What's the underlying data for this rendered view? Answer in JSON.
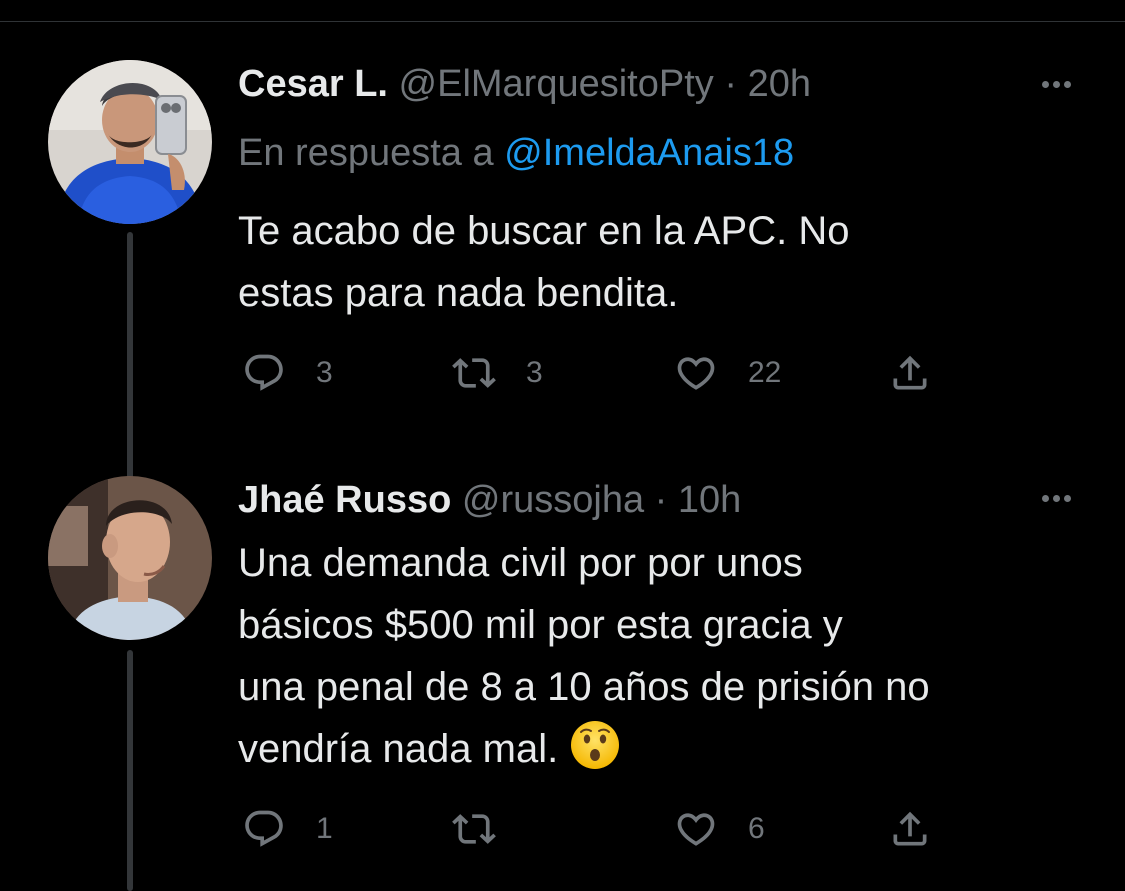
{
  "theme": {
    "background": "#000000",
    "text": "#e7e9ea",
    "secondary": "#71767b",
    "link": "#1d9bf0"
  },
  "tweets": [
    {
      "name": "Cesar L.",
      "handle": "@ElMarquesitoPty",
      "dot": "·",
      "time": "20h",
      "reply_prefix": "En respuesta a",
      "reply_mention": "@ImeldaAnais18",
      "text": "Te acabo de buscar en la APC. No\nestas para nada bendita.",
      "replies": "3",
      "retweets": "3",
      "likes": "22",
      "more_icon": "more-icon"
    },
    {
      "name": "Jhaé Russo",
      "handle": "@russojha",
      "dot": "·",
      "time": "10h",
      "text": "Una demanda civil por por unos\nbásicos $500 mil  por esta gracia y\nuna penal de 8 a 10 años de prisión no\nvendría nada mal.",
      "emoji": "hushed-face",
      "replies": "1",
      "retweets": "",
      "likes": "6",
      "more_icon": "more-icon"
    }
  ]
}
